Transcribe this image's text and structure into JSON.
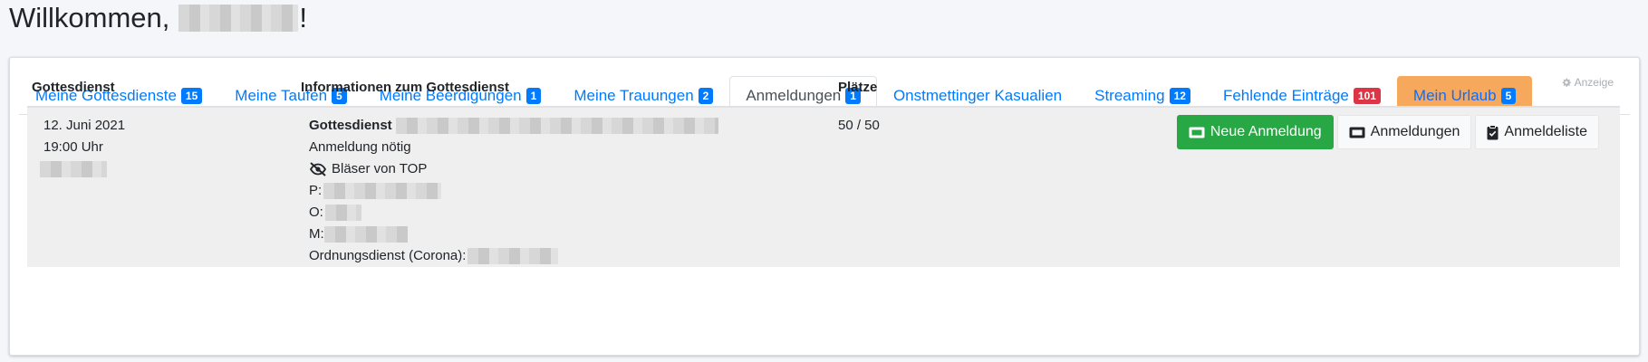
{
  "welcome": {
    "prefix": "Willkommen,",
    "suffix": "!"
  },
  "tabs": [
    {
      "label": "Meine Gottesdienste",
      "badge": "15"
    },
    {
      "label": "Meine Taufen",
      "badge": "5"
    },
    {
      "label": "Meine Beerdigungen",
      "badge": "1"
    },
    {
      "label": "Meine Trauungen",
      "badge": "2"
    },
    {
      "label": "Anmeldungen",
      "badge": "1"
    },
    {
      "label": "Onstmettinger Kasualien"
    },
    {
      "label": "Streaming",
      "badge": "12"
    },
    {
      "label": "Fehlende Einträge",
      "badge": "101"
    },
    {
      "label": "Mein Urlaub",
      "badge": "5"
    }
  ],
  "anzeige": "Anzeige",
  "table": {
    "headers": [
      "Gottesdienst",
      "Informationen zum Gottesdienst",
      "Plätze"
    ],
    "row": {
      "date": "12. Juni 2021",
      "time": "19:00 Uhr",
      "title": "Gottesdienst",
      "registration": "Anmeldung nötig",
      "music": "Bläser von TOP",
      "p_label": "P:",
      "o_label": "O:",
      "m_label": "M:",
      "ordnung_label": "Ordnungsdienst (Corona):",
      "places": "50 / 50"
    }
  },
  "buttons": {
    "new_registration": "Neue Anmeldung",
    "registrations": "Anmeldungen",
    "registration_list": "Anmeldeliste"
  },
  "colors": {
    "link": "#007bff",
    "success": "#28a745",
    "danger": "#dc3545",
    "vacation": "#f6a85d"
  },
  "icons": [
    "gear-icon",
    "eye-slash-icon",
    "ticket-icon",
    "clipboard-check-icon"
  ]
}
